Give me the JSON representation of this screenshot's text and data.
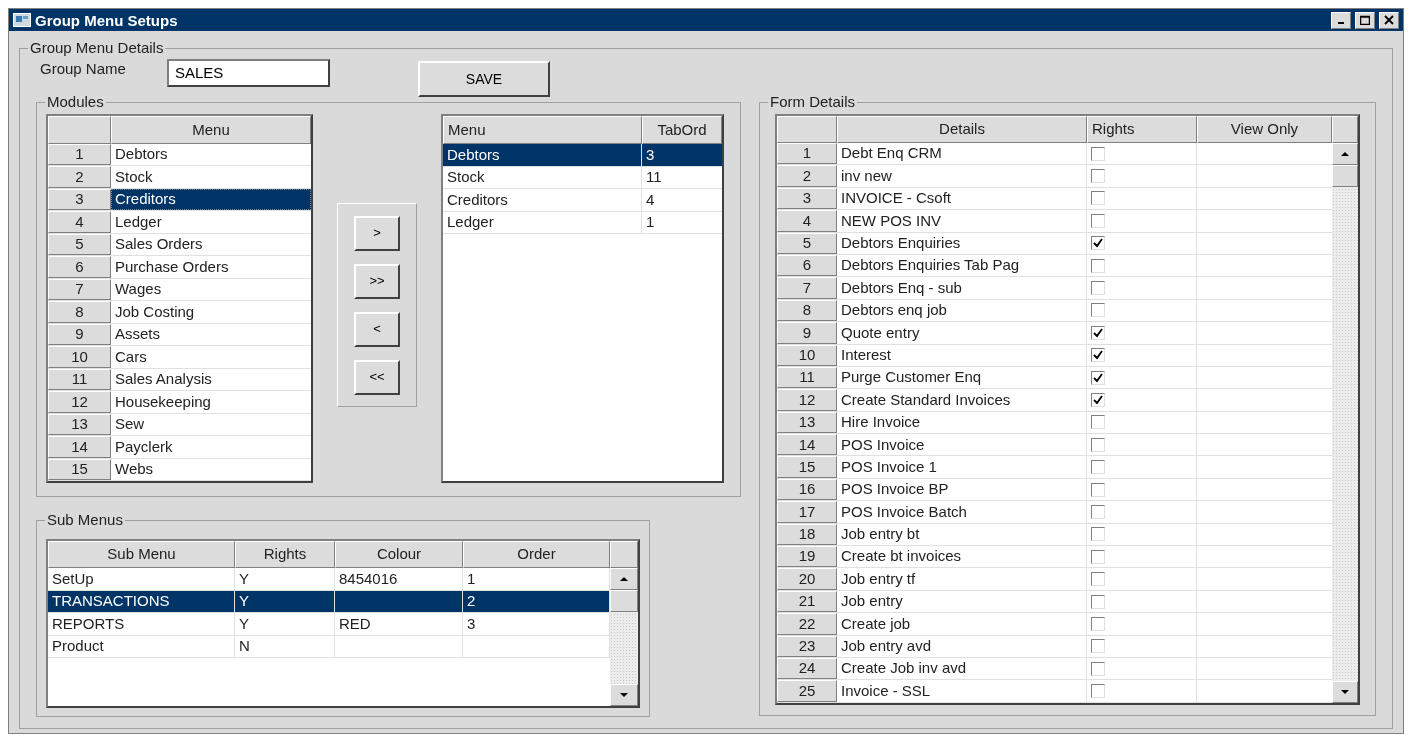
{
  "window": {
    "title": "Group Menu Setups"
  },
  "group_details": {
    "legend": "Group Menu Details",
    "group_name_label": "Group Name",
    "group_name": "SALES",
    "save_button": "SAVE"
  },
  "modules": {
    "legend": "Modules",
    "columns": [
      "Menu"
    ],
    "items": [
      {
        "number": "1",
        "label": "Debtors",
        "selected": false
      },
      {
        "number": "2",
        "label": "Stock",
        "selected": false
      },
      {
        "number": "3",
        "label": "Creditors",
        "selected": true
      },
      {
        "number": "4",
        "label": "Ledger",
        "selected": false
      },
      {
        "number": "5",
        "label": "Sales Orders",
        "selected": false
      },
      {
        "number": "6",
        "label": "Purchase Orders",
        "selected": false
      },
      {
        "number": "7",
        "label": "Wages",
        "selected": false
      },
      {
        "number": "8",
        "label": "Job Costing",
        "selected": false
      },
      {
        "number": "9",
        "label": "Assets",
        "selected": false
      },
      {
        "number": "10",
        "label": "Cars",
        "selected": false
      },
      {
        "number": "11",
        "label": "Sales Analysis",
        "selected": false
      },
      {
        "number": "12",
        "label": "Housekeeping",
        "selected": false
      },
      {
        "number": "13",
        "label": "Sew",
        "selected": false
      },
      {
        "number": "14",
        "label": "Payclerk",
        "selected": false
      },
      {
        "number": "15",
        "label": "Webs",
        "selected": false
      }
    ],
    "move_buttons": [
      ">",
      ">>",
      "<",
      "<<"
    ],
    "chosen_columns": [
      "Menu",
      "TabOrd"
    ],
    "chosen": [
      {
        "menu": "Debtors",
        "tab_order": "3",
        "selected": true
      },
      {
        "menu": "Stock",
        "tab_order": "11",
        "selected": false
      },
      {
        "menu": "Creditors",
        "tab_order": "4",
        "selected": false
      },
      {
        "menu": "Ledger",
        "tab_order": "1",
        "selected": false
      }
    ]
  },
  "sub_menus": {
    "legend": "Sub Menus",
    "columns": [
      "Sub Menu",
      "Rights",
      "Colour",
      "Order"
    ],
    "rows": [
      {
        "sub_menu": "SetUp",
        "rights": "Y",
        "colour": "8454016",
        "order": "1",
        "selected": false
      },
      {
        "sub_menu": "TRANSACTIONS",
        "rights": "Y",
        "order": "2",
        "selected": true
      },
      {
        "sub_menu": "REPORTS",
        "rights": "Y",
        "colour": "RED",
        "order": "3",
        "selected": false
      },
      {
        "sub_menu": "Product",
        "rights": "N",
        "selected": false
      }
    ]
  },
  "form_details": {
    "legend": "Form Details",
    "columns": [
      "Details",
      "Rights",
      "View Only"
    ],
    "rows": [
      {
        "number": "1",
        "details": "Debt Enq CRM",
        "rights": false
      },
      {
        "number": "2",
        "details": "inv new",
        "rights": false
      },
      {
        "number": "3",
        "details": "INVOICE - Csoft",
        "rights": false
      },
      {
        "number": "4",
        "details": "NEW POS INV",
        "rights": false
      },
      {
        "number": "5",
        "details": "Debtors Enquiries",
        "rights": true
      },
      {
        "number": "6",
        "details": "Debtors Enquiries Tab Pag",
        "rights": false
      },
      {
        "number": "7",
        "details": "Debtors Enq - sub",
        "rights": false
      },
      {
        "number": "8",
        "details": "Debtors enq job",
        "rights": false
      },
      {
        "number": "9",
        "details": "Quote entry",
        "rights": true
      },
      {
        "number": "10",
        "details": "Interest",
        "rights": true
      },
      {
        "number": "11",
        "details": "Purge Customer Enq",
        "rights": true
      },
      {
        "number": "12",
        "details": "Create Standard Invoices",
        "rights": true
      },
      {
        "number": "13",
        "details": "Hire Invoice",
        "rights": false
      },
      {
        "number": "14",
        "details": "POS Invoice",
        "rights": false
      },
      {
        "number": "15",
        "details": "POS Invoice 1",
        "rights": false
      },
      {
        "number": "16",
        "details": "POS Invoice BP",
        "rights": false
      },
      {
        "number": "17",
        "details": "POS Invoice Batch",
        "rights": false
      },
      {
        "number": "18",
        "details": "Job entry bt",
        "rights": false
      },
      {
        "number": "19",
        "details": "Create bt invoices",
        "rights": false
      },
      {
        "number": "20",
        "details": "Job entry tf",
        "rights": false
      },
      {
        "number": "21",
        "details": "Job entry",
        "rights": false
      },
      {
        "number": "22",
        "details": "Create job",
        "rights": false
      },
      {
        "number": "23",
        "details": "Job entry avd",
        "rights": false
      },
      {
        "number": "24",
        "details": "Create Job inv avd",
        "rights": false
      },
      {
        "number": "25",
        "details": "Invoice - SSL",
        "rights": false
      }
    ]
  }
}
